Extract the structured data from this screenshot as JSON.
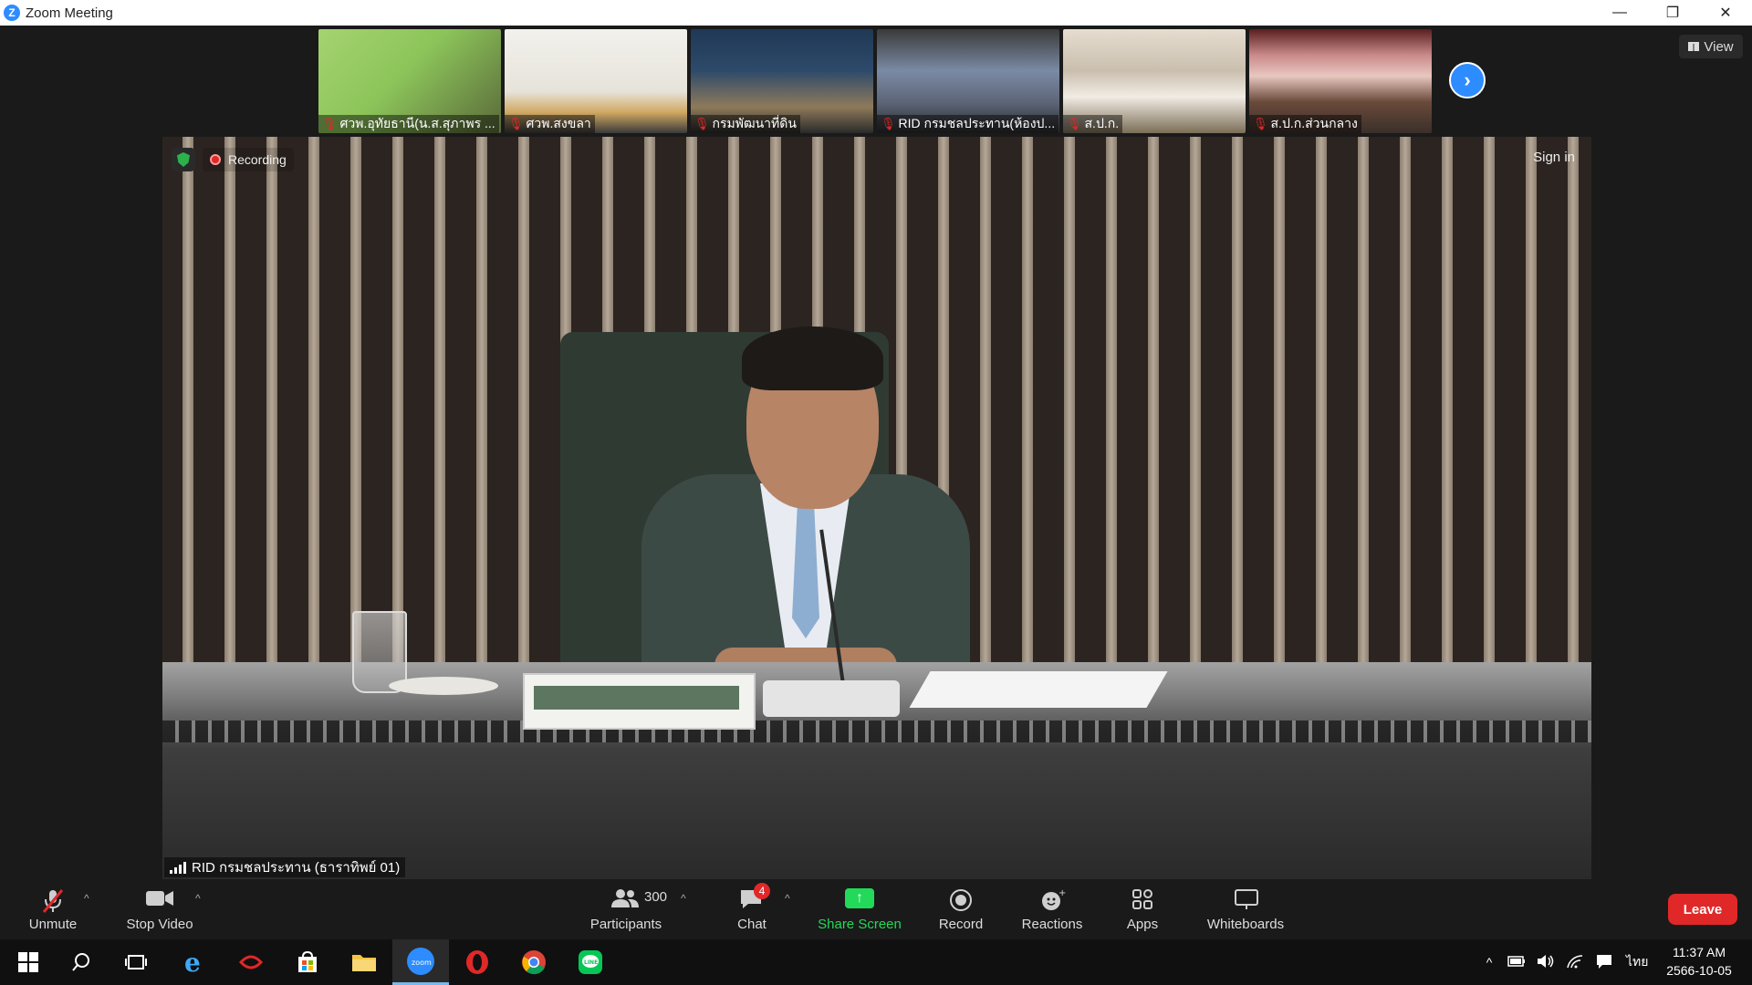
{
  "window": {
    "title": "Zoom Meeting",
    "controls": {
      "minimize": "—",
      "restore": "❐",
      "close": "✕"
    }
  },
  "thumbnails": [
    {
      "name": "ศวพ.อุทัยธานี(น.ส.สุภาพร ..."
    },
    {
      "name": "ศวพ.สงขลา"
    },
    {
      "name": "กรมพัฒนาที่ดิน"
    },
    {
      "name": "RID กรมชลประทาน(ห้องป..."
    },
    {
      "name": "ส.ป.ก."
    },
    {
      "name": "ส.ป.ก.ส่วนกลาง"
    }
  ],
  "view_button": {
    "label": "View"
  },
  "main_video": {
    "recording_label": "Recording",
    "sign_in": "Sign in",
    "speaker_name": "RID กรมชลประทาน (ธาราทิพย์ 01)"
  },
  "toolbar": {
    "unmute": "Unmute",
    "stop_video": "Stop Video",
    "participants": "Participants",
    "participants_count": "300",
    "chat": "Chat",
    "chat_badge": "4",
    "share_screen": "Share Screen",
    "record": "Record",
    "reactions": "Reactions",
    "apps": "Apps",
    "whiteboards": "Whiteboards",
    "leave": "Leave"
  },
  "taskbar": {
    "language": "ไทย",
    "time": "11:37 AM",
    "date": "2566-10-05"
  },
  "colors": {
    "accent": "#2d8cff",
    "leave": "#e02828",
    "share": "#23d959"
  }
}
